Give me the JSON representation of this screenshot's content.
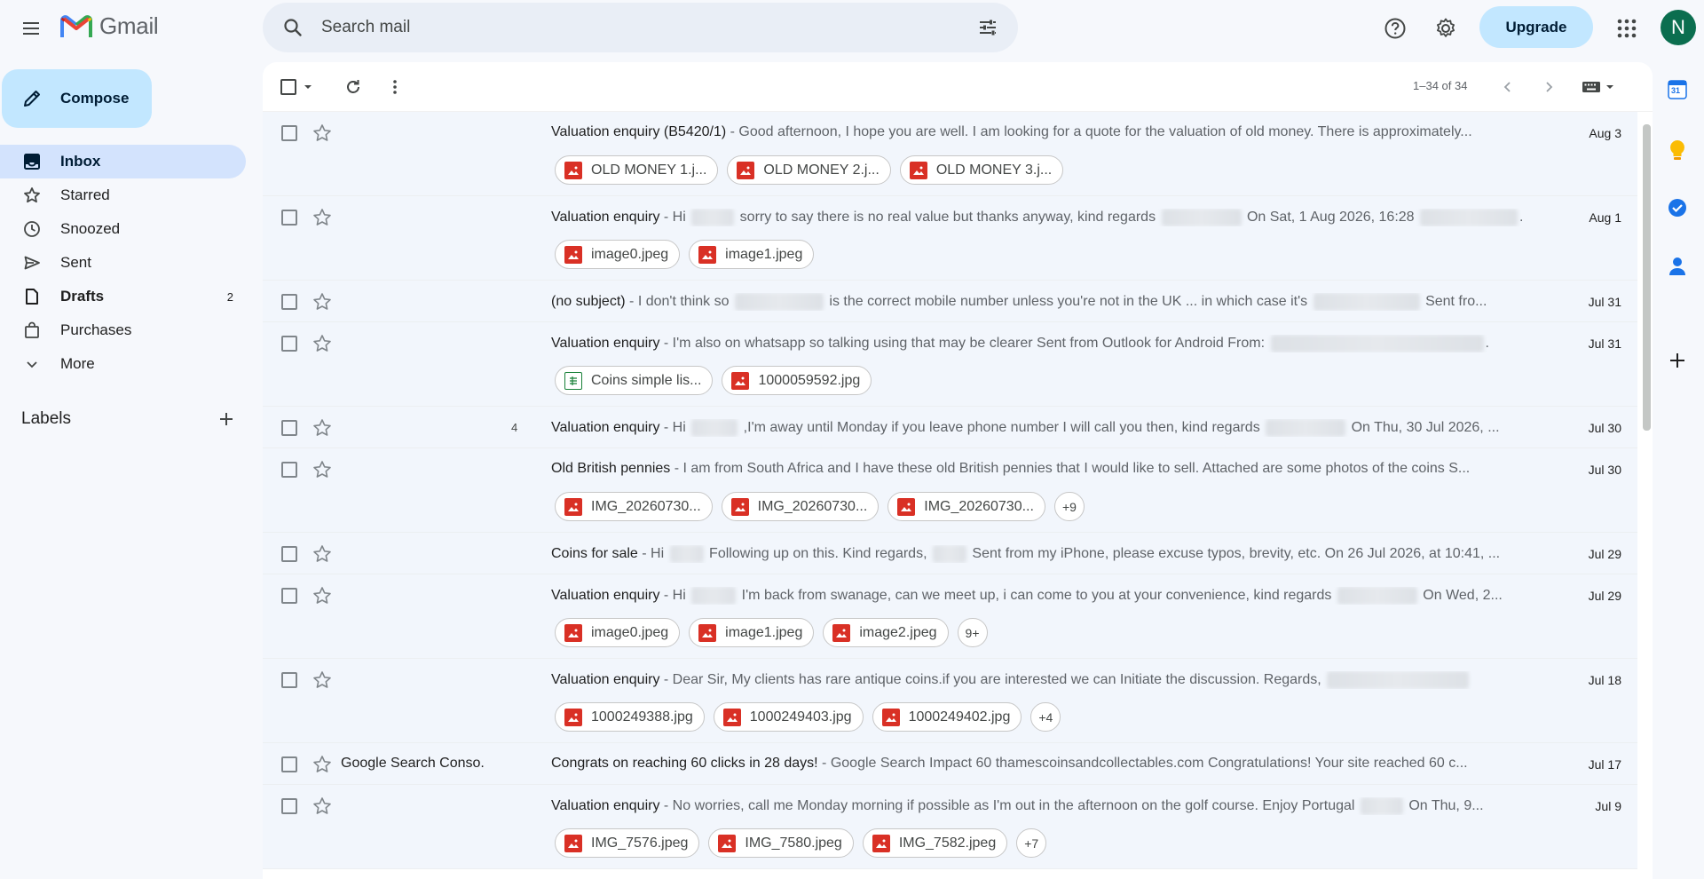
{
  "app": {
    "name": "Gmail"
  },
  "search": {
    "placeholder": "Search mail"
  },
  "header": {
    "upgrade_label": "Upgrade",
    "avatar_letter": "N"
  },
  "compose": {
    "label": "Compose"
  },
  "sidebar": {
    "items": [
      {
        "label": "Inbox",
        "icon": "inbox-icon",
        "count": ""
      },
      {
        "label": "Starred",
        "icon": "star-icon",
        "count": ""
      },
      {
        "label": "Snoozed",
        "icon": "clock-icon",
        "count": ""
      },
      {
        "label": "Sent",
        "icon": "send-icon",
        "count": ""
      },
      {
        "label": "Drafts",
        "icon": "draft-icon",
        "count": "2"
      },
      {
        "label": "Purchases",
        "icon": "shopping-bag-icon",
        "count": ""
      },
      {
        "label": "More",
        "icon": "chevron-down-icon",
        "count": ""
      }
    ],
    "labels_heading": "Labels"
  },
  "toolbar": {
    "pagination": "1–34 of 34"
  },
  "side_panel": {
    "calendar_day": "31"
  },
  "emails": [
    {
      "sender": "",
      "thread_count": "",
      "subject": "Valuation enquiry (B5420/1)",
      "snippet": " - Good afternoon, I hope you are well. I am looking for a quote for the valuation of old money. There is approximately...",
      "date": "Aug 3",
      "attachments": [
        "OLD MONEY 1.j...",
        "OLD MONEY 2.j...",
        "OLD MONEY 3.j..."
      ],
      "more": ""
    },
    {
      "sender": "",
      "thread_count": "",
      "subject": "Valuation enquiry",
      "snippet_parts": [
        " - Hi ",
        " sorry to say there is no real value but thanks anyway, kind regards ",
        " On Sat, 1 Aug 2026, 16:28 ",
        ".."
      ],
      "date": "Aug 1",
      "attachments": [
        "image0.jpeg",
        "image1.jpeg"
      ],
      "more": ""
    },
    {
      "sender": "",
      "thread_count": "",
      "subject": "(no subject)",
      "snippet_parts": [
        " - I don't think so ",
        " is the correct mobile number unless you're not in the UK ... in which case it's ",
        " Sent fro..."
      ],
      "date": "Jul 31",
      "attachments": [],
      "more": ""
    },
    {
      "sender": "",
      "thread_count": "",
      "subject": "Valuation enquiry",
      "snippet_parts": [
        " - I'm also on whatsapp so talking using that may be clearer Sent from Outlook for Android From: ",
        "."
      ],
      "date": "Jul 31",
      "attachments": [
        "Coins simple lis...",
        "1000059592.jpg"
      ],
      "more": ""
    },
    {
      "sender": "",
      "thread_count": "4",
      "subject": "Valuation enquiry",
      "snippet_parts": [
        " - Hi ",
        " ,I'm away until Monday if you leave phone number I will call you then, kind regards ",
        " On Thu, 30 Jul 2026, ..."
      ],
      "date": "Jul 30",
      "attachments": [],
      "more": ""
    },
    {
      "sender": "",
      "thread_count": "",
      "subject": "Old British pennies",
      "snippet": " - I am from South Africa and I have these old British pennies that I would like to sell. Attached are some photos of the coins S...",
      "date": "Jul 30",
      "attachments": [
        "IMG_20260730...",
        "IMG_20260730...",
        "IMG_20260730..."
      ],
      "more": "+9"
    },
    {
      "sender": "",
      "thread_count": "",
      "subject": "Coins for sale",
      "snippet_parts": [
        " - Hi ",
        " Following up on this. Kind regards, ",
        " Sent from my iPhone, please excuse typos, brevity, etc. On 26 Jul 2026, at 10:41, ..."
      ],
      "date": "Jul 29",
      "attachments": [],
      "more": ""
    },
    {
      "sender": "",
      "thread_count": "",
      "subject": "Valuation enquiry",
      "snippet_parts": [
        " - Hi ",
        " I'm back from swanage, can we meet up, i can come to you at your convenience, kind regards ",
        " On Wed, 2..."
      ],
      "date": "Jul 29",
      "attachments": [
        "image0.jpeg",
        "image1.jpeg",
        "image2.jpeg"
      ],
      "more": "9+"
    },
    {
      "sender": "",
      "thread_count": "",
      "subject": "Valuation enquiry",
      "snippet_parts": [
        " - Dear Sir, My clients has rare antique coins.if you are interested we can Initiate the discussion. Regards, ",
        ""
      ],
      "date": "Jul 18",
      "attachments": [
        "1000249388.jpg",
        "1000249403.jpg",
        "1000249402.jpg"
      ],
      "more": "+4"
    },
    {
      "sender": "Google Search Conso.",
      "thread_count": "",
      "subject": "Congrats on reaching 60 clicks in 28 days!",
      "snippet": " - Google Search Impact 60 thamescoinsandcollectables.com Congratulations! Your site reached 60 c...",
      "date": "Jul 17",
      "attachments": [],
      "more": ""
    },
    {
      "sender": "",
      "thread_count": "",
      "subject": "Valuation enquiry",
      "snippet_parts": [
        " - No worries, call me Monday morning if possible as I'm out in the afternoon on the golf course. Enjoy Portugal ",
        " On Thu, 9..."
      ],
      "date": "Jul 9",
      "attachments": [
        "IMG_7576.jpeg",
        "IMG_7580.jpeg",
        "IMG_7582.jpeg"
      ],
      "more": "+7"
    }
  ],
  "colors": {
    "accent": "#0b57d0",
    "compose_bg": "#c2e7ff",
    "active_nav": "#d3e3fd",
    "attachment_icon": "#d93025"
  }
}
